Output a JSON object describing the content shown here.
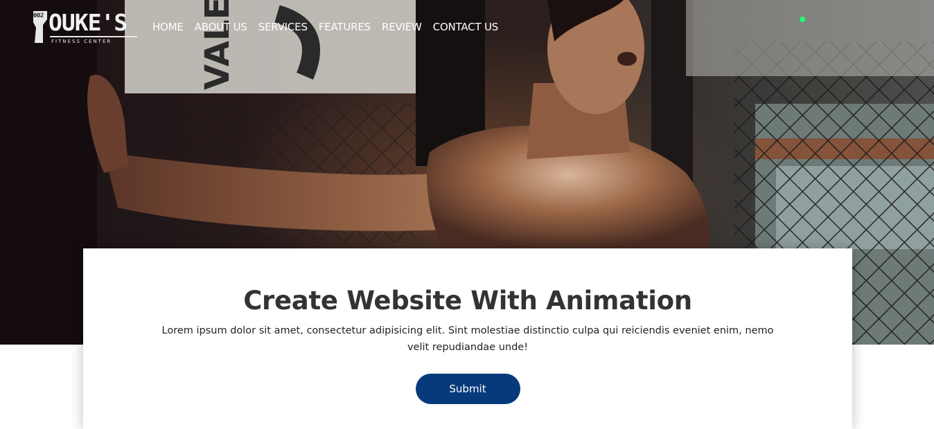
{
  "brand": {
    "tag": "002",
    "name": "OUKE'S",
    "tagline": "FITNESS CENTER"
  },
  "nav": {
    "items": [
      {
        "label": "HOME"
      },
      {
        "label": "ABOUT US"
      },
      {
        "label": "SERVICES"
      },
      {
        "label": "FEATURES"
      },
      {
        "label": "REVIEW"
      },
      {
        "label": "CONTACT US"
      }
    ]
  },
  "hero": {
    "image": "athlete-in-gym-cage-photo"
  },
  "card": {
    "title": "Create Website With Animation",
    "text": "Lorem ipsum dolor sit amet, consectetur adipisicing elit. Sint molestiae distinctio culpa qui reiciendis eveniet enim, nemo velit repudiandae unde!",
    "button_label": "Submit"
  },
  "colors": {
    "button": "#063a7a",
    "heading": "#333333",
    "nav_text": "#ffffff"
  }
}
